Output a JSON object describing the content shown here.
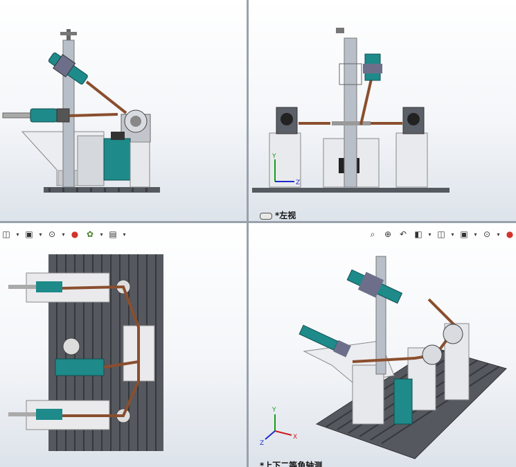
{
  "views": {
    "top_right": {
      "label": "*左视"
    },
    "bottom_right": {
      "label": "*上下二等角轴测"
    }
  },
  "triad": {
    "x": "X",
    "y": "Y",
    "z": "Z"
  },
  "toolbars": {
    "bottom_left": [
      "orient-icon",
      "display-style-icon",
      "hide-show-icon",
      "appearance-icon",
      "scene-icon",
      "view-settings-icon"
    ],
    "bottom_right": [
      "zoom-to-fit-icon",
      "zoom-area-icon",
      "previous-view-icon",
      "section-view-icon",
      "view-orientation-icon",
      "display-style-icon",
      "hide-show-icon",
      "appearance-icon"
    ]
  },
  "colors": {
    "teal": "#1e8a8a",
    "frame": "#eaeaec",
    "base": "#4b4f55",
    "steel": "#9aa3ad",
    "arm": "#8a4e2e"
  }
}
